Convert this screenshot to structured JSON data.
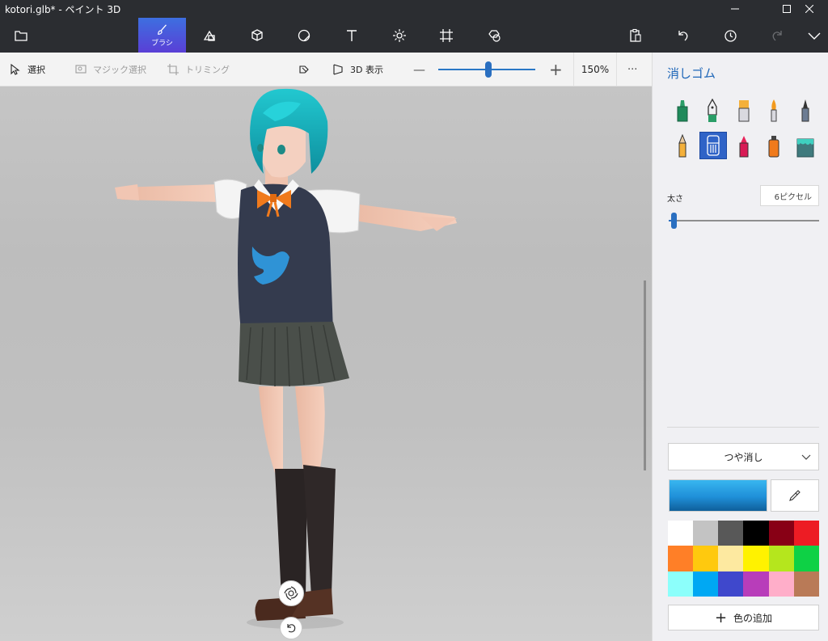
{
  "window": {
    "title": "kotori.glb* - ペイント 3D"
  },
  "toolbar": {
    "brush_label": "ブラシ",
    "icons": [
      "menu-icon",
      "brushes-icon",
      "2d-shapes-icon",
      "3d-shapes-icon",
      "stickers-icon",
      "text-icon",
      "effects-icon",
      "canvas-icon",
      "3d-library-icon",
      "paste-icon",
      "undo-icon",
      "history-icon",
      "redo-icon",
      "expand-icon"
    ]
  },
  "subbar": {
    "select_label": "選択",
    "magic_select_label": "マジック選択",
    "crop_label": "トリミング",
    "view3d_label": "3D 表示",
    "zoom_out_symbol": "—",
    "zoom_in_symbol": "+",
    "zoom_value": "150%",
    "zoom_fraction": 0.52,
    "more_symbol": "···"
  },
  "panel": {
    "title": "消しゴム",
    "size_label": "太さ",
    "size_value": "6ピクセル",
    "finish": "つや消し",
    "current_color": "#1f8fd8",
    "add_color_label": "色の追加",
    "brushes": [
      {
        "name": "marker",
        "selected": false
      },
      {
        "name": "calligraphy-pen",
        "selected": false
      },
      {
        "name": "oil-brush",
        "selected": false
      },
      {
        "name": "watercolor",
        "selected": false
      },
      {
        "name": "pixel-pen",
        "selected": false
      },
      {
        "name": "pencil",
        "selected": false
      },
      {
        "name": "eraser",
        "selected": true
      },
      {
        "name": "crayon",
        "selected": false
      },
      {
        "name": "spray-can",
        "selected": false
      },
      {
        "name": "fill",
        "selected": false
      }
    ],
    "swatches": [
      "#ffffff",
      "#c3c3c3",
      "#585858",
      "#000000",
      "#880015",
      "#ed1c24",
      "#ff7f27",
      "#ffc90e",
      "#fde9a0",
      "#fff200",
      "#b5e61d",
      "#0ed145",
      "#8cfffb",
      "#00a8f3",
      "#3f48cc",
      "#b83dba",
      "#ffaec9",
      "#b97a57"
    ]
  }
}
